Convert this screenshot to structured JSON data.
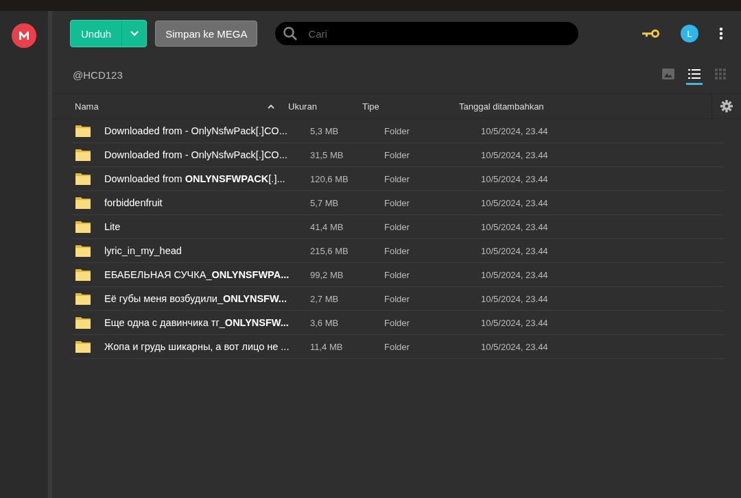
{
  "toolbar": {
    "download_button": "Unduh",
    "save_button": "Simpan ke MEGA",
    "search": {
      "placeholder": "Cari"
    },
    "avatar_letter": "L"
  },
  "owner": "@HCD123",
  "view_modes": [
    {
      "kind": "thumbnail",
      "selected": false
    },
    {
      "kind": "list",
      "selected": true
    },
    {
      "kind": "grid",
      "selected": false
    }
  ],
  "table": {
    "columns": [
      {
        "label": "Nama",
        "sorted": true
      },
      {
        "label": "Ukuran",
        "sorted": false
      },
      {
        "label": "Tipe",
        "sorted": false
      },
      {
        "label": "Tanggal ditambahkan",
        "sorted": false
      }
    ],
    "rows": [
      {
        "name": "Downloaded from - OnlyNsfwPack[.]CO...",
        "size": "5,3 MB",
        "type": "Folder",
        "date": "10/5/2024, 23.44"
      },
      {
        "name": "Downloaded from - OnlyNsfwPack[.]CO...",
        "size": "31,5 MB",
        "type": "Folder",
        "date": "10/5/2024, 23.44"
      },
      {
        "name": "Downloaded from **ONLYNSFWPACK**[.]...",
        "size": "120,6 MB",
        "type": "Folder",
        "date": "10/5/2024, 23.44"
      },
      {
        "name": "forbiddenfruit",
        "size": "5,7 MB",
        "type": "Folder",
        "date": "10/5/2024, 23.44"
      },
      {
        "name": "Lite",
        "size": "41,4 MB",
        "type": "Folder",
        "date": "10/5/2024, 23.44"
      },
      {
        "name": "lyric_in_my_head",
        "size": "215,6 MB",
        "type": "Folder",
        "date": "10/5/2024, 23.44"
      },
      {
        "name": "ЕБАБЕЛЬНАЯ СУЧКА_**ONLYNSFWPA...**",
        "size": "99,2 MB",
        "type": "Folder",
        "date": "10/5/2024, 23.44"
      },
      {
        "name": "Её губы меня возбудили_**ONLYNSFW...**",
        "size": "2,7 MB",
        "type": "Folder",
        "date": "10/5/2024, 23.44"
      },
      {
        "name": "Еще одна с давинчика тг_**ONLYNSFW...**",
        "size": "3,6 MB",
        "type": "Folder",
        "date": "10/5/2024, 23.44"
      },
      {
        "name": "Жопа и грудь шикарны, а вот лицо не ...",
        "size": "11,4 MB",
        "type": "Folder",
        "date": "10/5/2024, 23.44"
      }
    ]
  }
}
